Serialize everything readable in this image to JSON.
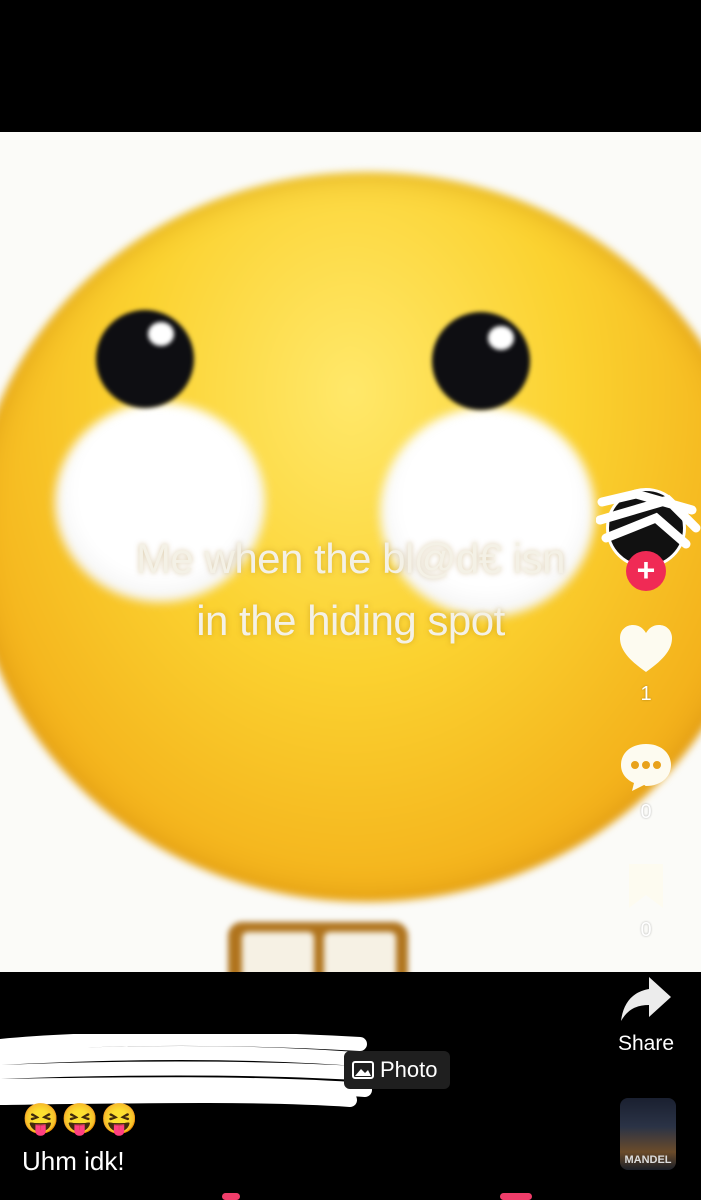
{
  "post": {
    "caption_line1": "Me when the bl@d€ isn",
    "caption_line2": "in the hiding spot",
    "content_type_tag": "Photo",
    "description_emojis": "😝😝😝",
    "description": "Uhm idk!"
  },
  "actions": {
    "likes": "1",
    "comments": "0",
    "saves": "0",
    "share_label": "Share"
  },
  "music_disc": {
    "label": "MANDEL"
  },
  "colors": {
    "follow_badge": "#f02a55",
    "background": "#000000",
    "emoji_face": "#fbd230"
  },
  "icons": {
    "like": "heart-icon",
    "comment": "comment-bubble-icon",
    "save": "bookmark-icon",
    "share": "share-arrow-icon",
    "follow": "plus-icon",
    "photo": "photo-icon"
  }
}
